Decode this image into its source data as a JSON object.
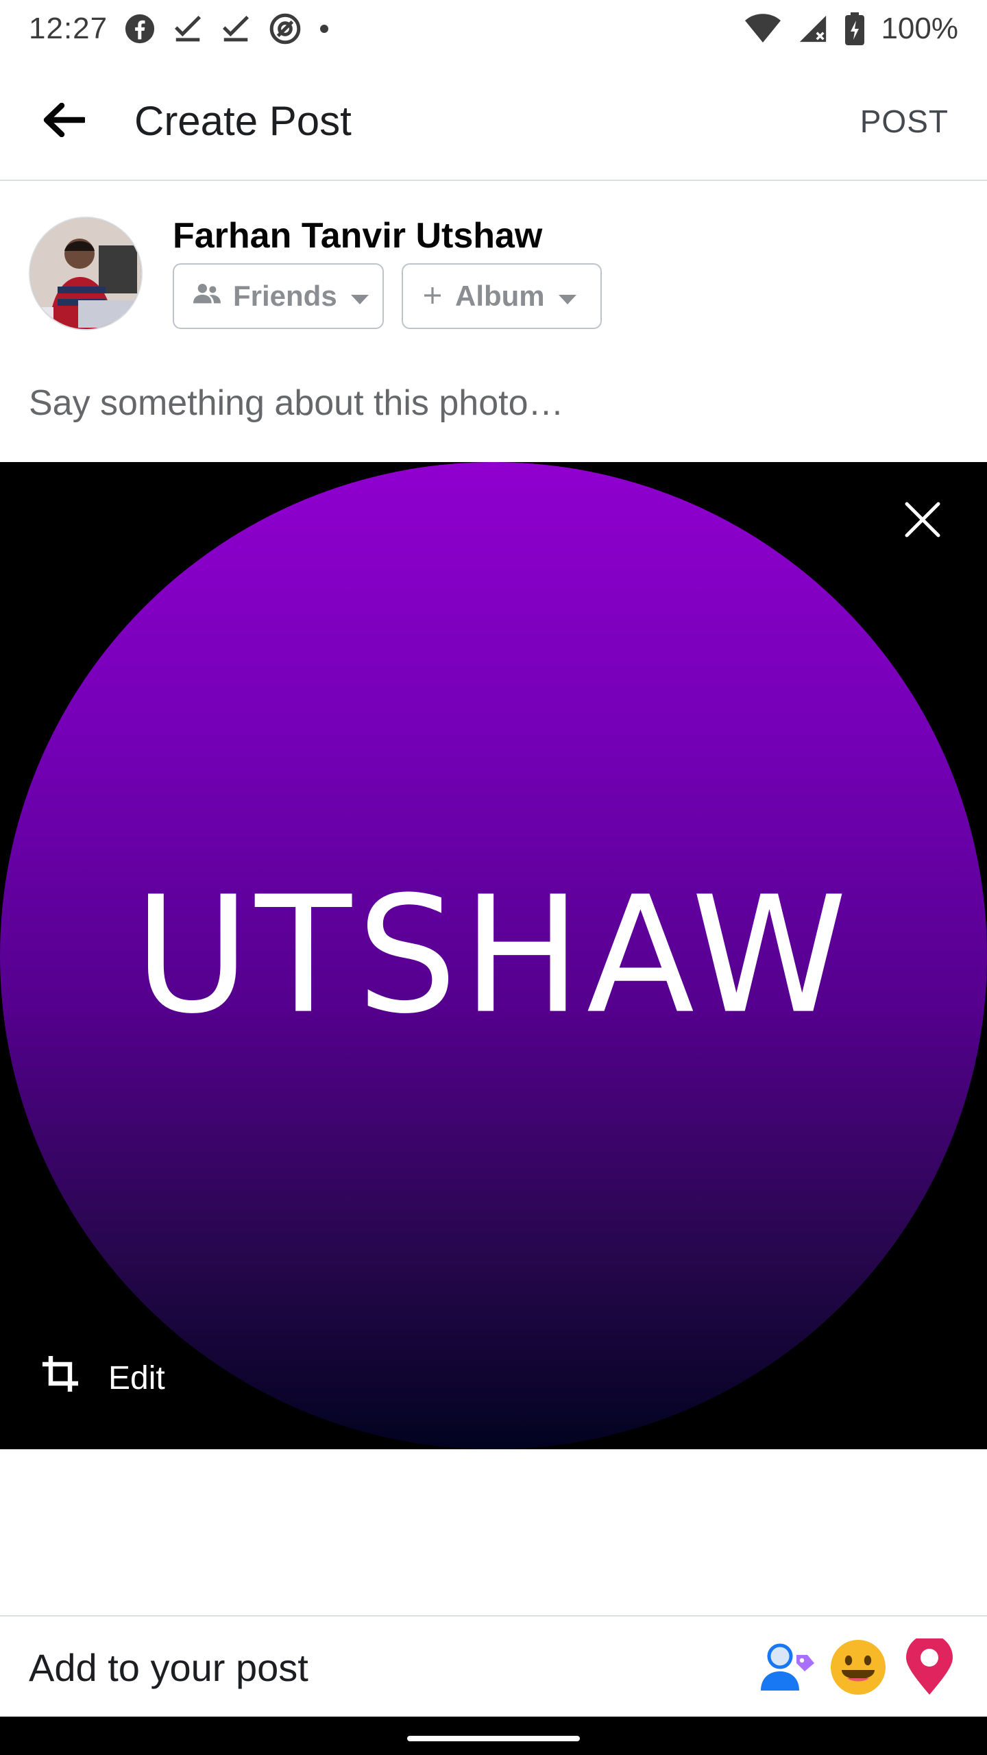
{
  "status_bar": {
    "time": "12:27",
    "battery": "100%",
    "icons": [
      "facebook-icon",
      "download-done-icon",
      "download-done-icon",
      "at-sign-icon",
      "dot-icon",
      "wifi-icon",
      "signal-icon",
      "battery-charging-icon"
    ]
  },
  "app_bar": {
    "title": "Create Post",
    "post_label": "POST"
  },
  "author": {
    "name": "Farhan Tanvir Utshaw",
    "audience_label": "Friends",
    "album_label": "Album"
  },
  "composer": {
    "placeholder": "Say something about this photo…"
  },
  "photo": {
    "text": "UTSHAW",
    "edit_label": "Edit"
  },
  "add_to_post": {
    "label": "Add to your post",
    "icons": [
      "tag-people-icon",
      "feeling-emoji-icon",
      "location-pin-icon"
    ]
  },
  "colors": {
    "purple_top": "#9000cf",
    "purple_bottom": "#020320",
    "chip_text": "#8a8d91",
    "location_red": "#e0245e",
    "emoji_yellow": "#f7b928"
  }
}
